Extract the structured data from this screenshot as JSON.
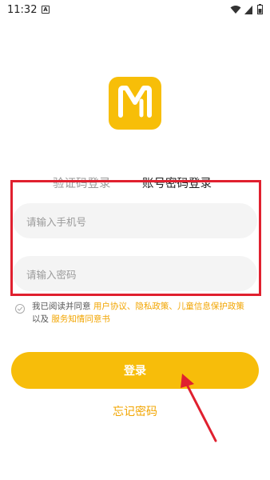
{
  "status_bar": {
    "time": "11:32",
    "notification_icon": "A"
  },
  "logo": {
    "name": "app-logo"
  },
  "tabs": [
    {
      "label": "验证码登录",
      "active": false
    },
    {
      "label": "账号密码登录",
      "active": true
    }
  ],
  "form": {
    "phone_placeholder": "请输入手机号",
    "password_placeholder": "请输入密码"
  },
  "agreement": {
    "prefix": "我已阅读并同意 ",
    "link1": "用户协议",
    "sep1": "、",
    "link2": "隐私政策",
    "sep2": "、",
    "link3": "儿童信息保护政策",
    "line2_prefix": "以及 ",
    "link4": "服务知情同意书"
  },
  "buttons": {
    "login": "登录",
    "forgot_password": "忘记密码"
  },
  "colors": {
    "accent": "#f7bd0a",
    "link": "#f2a500",
    "highlight": "#e0202f"
  }
}
